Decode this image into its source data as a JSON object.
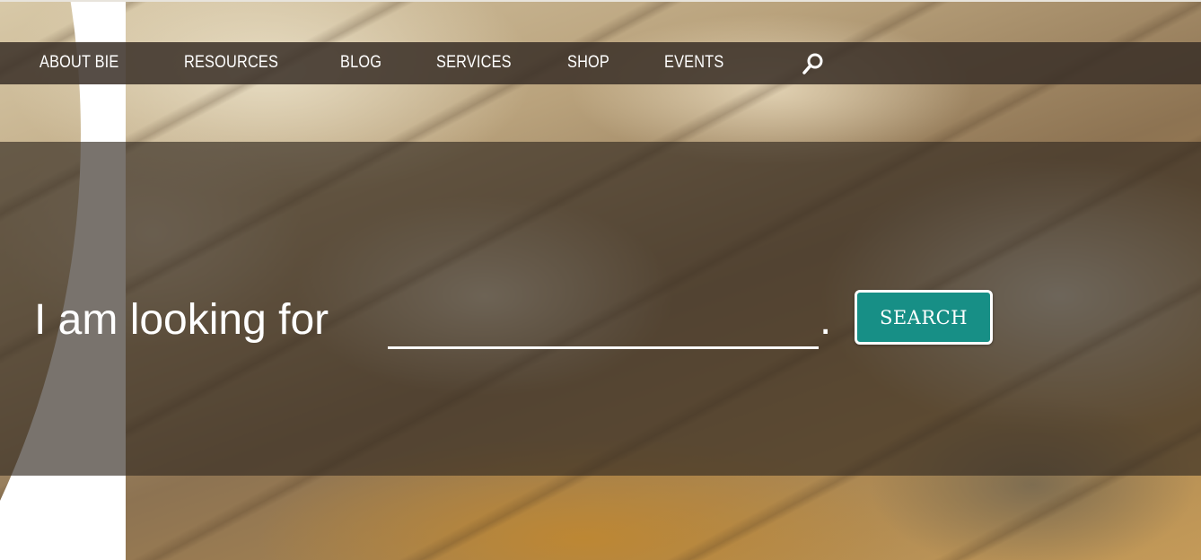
{
  "nav": {
    "items": [
      {
        "label": "ABOUT BIE"
      },
      {
        "label": "RESOURCES"
      },
      {
        "label": "BLOG"
      },
      {
        "label": "SERVICES"
      },
      {
        "label": "SHOP"
      },
      {
        "label": "EVENTS"
      }
    ],
    "search_icon": "search-icon"
  },
  "hero": {
    "lead_text": "I am looking for",
    "input_value": "",
    "input_placeholder": "",
    "period": ".",
    "search_button_label": "SEARCH"
  },
  "colors": {
    "nav_background": "#3a3028",
    "band_background": "#342a22",
    "search_button": "#178f86",
    "text": "#ffffff"
  }
}
